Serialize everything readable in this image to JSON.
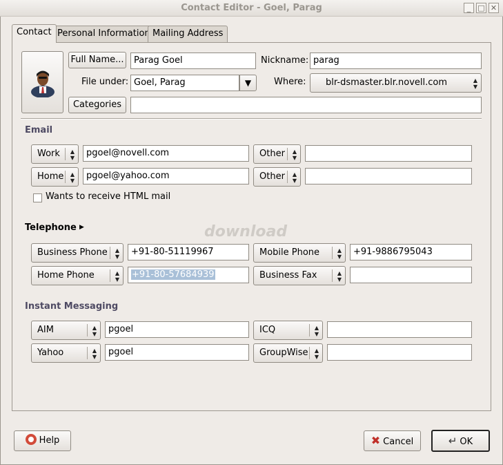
{
  "window": {
    "title": "Contact Editor - Goel, Parag"
  },
  "tabs": [
    {
      "label": "Contact"
    },
    {
      "label": "Personal Information"
    },
    {
      "label": "Mailing Address"
    }
  ],
  "identity": {
    "full_name_button": "Full Name...",
    "full_name_value": "Parag Goel",
    "nickname_label": "Nickname:",
    "nickname_value": "parag",
    "file_under_label": "File under:",
    "file_under_value": "Goel, Parag",
    "where_label": "Where:",
    "where_value": "blr-dsmaster.blr.novell.com",
    "categories_button": "Categories",
    "categories_value": ""
  },
  "email": {
    "heading": "Email",
    "rows": [
      {
        "type": "Work",
        "value": "pgoel@novell.com",
        "type2": "Other",
        "value2": ""
      },
      {
        "type": "Home",
        "value": "pgoel@yahoo.com",
        "type2": "Other",
        "value2": ""
      }
    ],
    "html_mail_label": "Wants to receive HTML mail"
  },
  "telephone": {
    "heading": "Telephone",
    "rows": [
      {
        "type": "Business Phone",
        "value": "+91-80-51119967",
        "type2": "Mobile Phone",
        "value2": "+91-9886795043"
      },
      {
        "type": "Home Phone",
        "value": "+91-80-57684939",
        "type2": "Business Fax",
        "value2": ""
      }
    ]
  },
  "instant_messaging": {
    "heading": "Instant Messaging",
    "rows": [
      {
        "type": "AIM",
        "value": "pgoel",
        "type2": "ICQ",
        "value2": ""
      },
      {
        "type": "Yahoo",
        "value": "pgoel",
        "type2": "GroupWise",
        "value2": ""
      }
    ]
  },
  "watermark": "download",
  "buttons": {
    "help": "Help",
    "cancel": "Cancel",
    "ok": "OK"
  },
  "colors": {
    "section_heading": "#4e4a63",
    "selection": "#a9c0d8",
    "cancel_icon": "#c0302a"
  }
}
